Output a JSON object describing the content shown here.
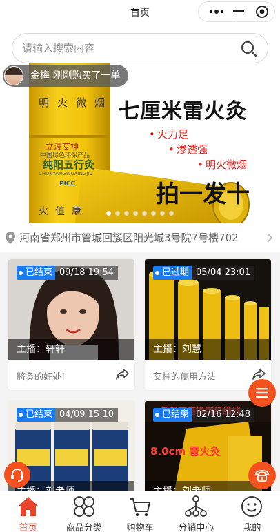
{
  "nav": {
    "title": "首页"
  },
  "search": {
    "placeholder": "请输入搜索内容"
  },
  "banner": {
    "notice": "金梅 刚刚购买了一单",
    "headline": "七厘米雷火灸",
    "features": [
      "火力足",
      "渗透强",
      "明火微烟"
    ],
    "slogan": "拍一发十",
    "product_text": {
      "top": "明火微烟",
      "brand": "立波艾神",
      "name": "纯阳五行灸",
      "pinyin": "CHUNYANGWUXINGJIU",
      "tag": "PICC",
      "bottom": "火值康",
      "desc": "中国绿色环保产品"
    },
    "slide_count": 8,
    "active_slide": 0
  },
  "address": {
    "text": "河南省郑州市管城回簇区阳光城3号院7号楼702"
  },
  "cards": [
    {
      "state": "已结束",
      "time": "09/18 19:54",
      "host": "主播：轩轩",
      "title": "脐灸的好处!"
    },
    {
      "state": "已过期",
      "time": "05/04 23:01",
      "host": "主播：刘慧",
      "title": "艾柱的使用方法"
    },
    {
      "state": "已结束",
      "time": "04/09 15:10",
      "host": "主播：刘老师",
      "title": ""
    },
    {
      "state": "已结束",
      "time": "02/16 12:48",
      "host": "主播：刘老师",
      "title": "",
      "poster_headline": "低温石磨搀制纤维线",
      "poster_size": "8.0cm 雷火灸"
    }
  ],
  "tabs": [
    {
      "label": "首页",
      "icon": "home-icon",
      "active": true
    },
    {
      "label": "商品分类",
      "icon": "category-icon",
      "active": false
    },
    {
      "label": "购物车",
      "icon": "cart-icon",
      "active": false
    },
    {
      "label": "分销中心",
      "icon": "distribution-icon",
      "active": false
    },
    {
      "label": "我的",
      "icon": "profile-icon",
      "active": false
    }
  ],
  "colors": {
    "accent": "#e8472e",
    "badge": "#1a7cf5",
    "float": "#f4511e"
  }
}
